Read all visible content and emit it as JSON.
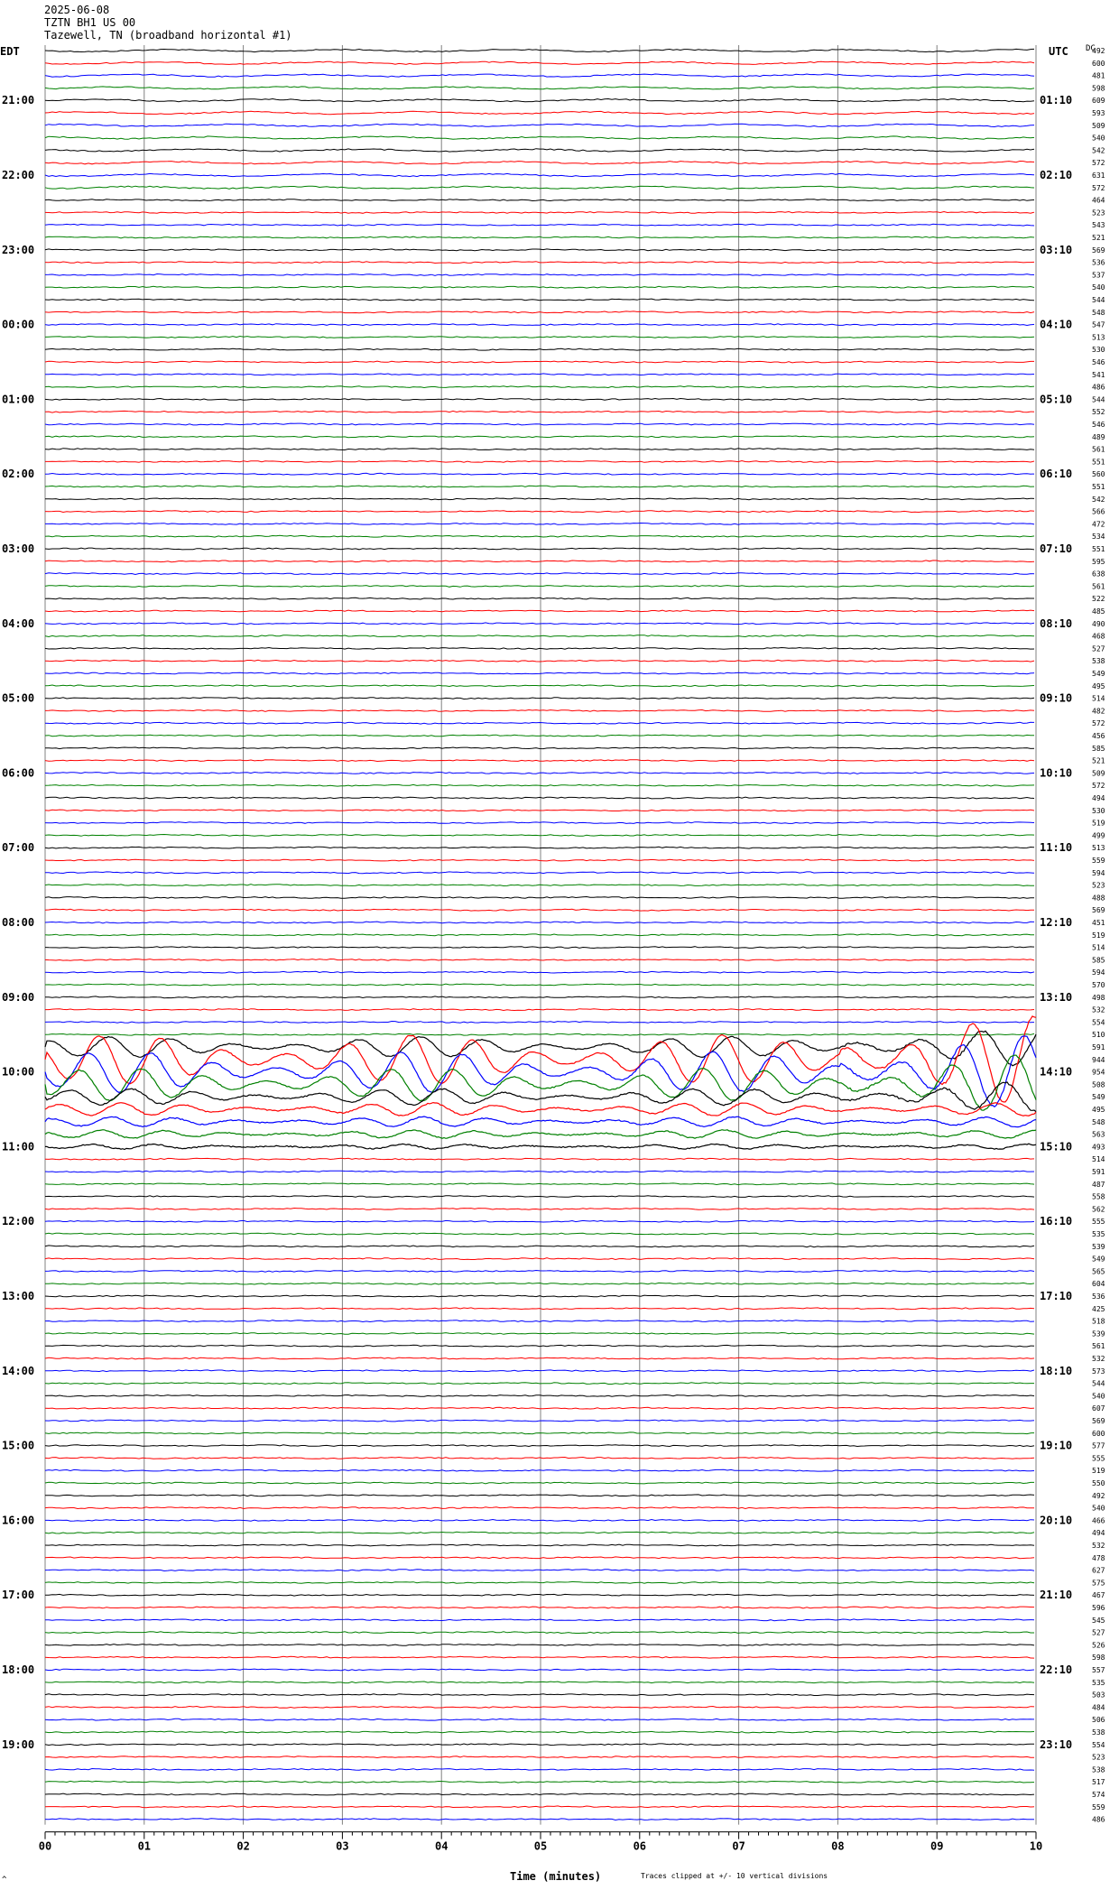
{
  "header": {
    "date": "2025-06-08",
    "station": "TZTN BH1 US 00",
    "location": "Tazewell, TN (broadband horizontal #1)"
  },
  "labels": {
    "left_tz": "EDT",
    "right_tz": "UTC",
    "right_col": "DC",
    "xlabel": "Time (minutes)",
    "clip_note": "Traces clipped at +/- 10 vertical divisions",
    "corner_mark": "^"
  },
  "chart_data": {
    "type": "line",
    "trace_colors": [
      "#000000",
      "#ff0000",
      "#0000ff",
      "#008000"
    ],
    "grid_color": "#808080",
    "x_ticks": [
      "00",
      "01",
      "02",
      "03",
      "04",
      "05",
      "06",
      "07",
      "08",
      "09",
      "10"
    ],
    "xlim": [
      0,
      10
    ],
    "left_hour_labels": [
      "21:00",
      "22:00",
      "23:00",
      "00:00",
      "01:00",
      "02:00",
      "03:00",
      "04:00",
      "05:00",
      "06:00",
      "07:00",
      "08:00",
      "09:00",
      "10:00",
      "11:00",
      "12:00",
      "13:00",
      "14:00",
      "15:00",
      "16:00",
      "17:00",
      "18:00",
      "19:00"
    ],
    "right_hour_labels": [
      "01:10",
      "02:10",
      "03:10",
      "04:10",
      "05:10",
      "06:10",
      "07:10",
      "08:10",
      "09:10",
      "10:10",
      "11:10",
      "12:10",
      "13:10",
      "14:10",
      "15:10",
      "16:10",
      "17:10",
      "18:10",
      "19:10",
      "20:10",
      "21:10",
      "22:10",
      "23:10"
    ],
    "dc_offsets": [
      "492",
      "600",
      "481",
      "598",
      "609",
      "593",
      "509",
      "540",
      "542",
      "572",
      "631",
      "572",
      "464",
      "523",
      "543",
      "521",
      "569",
      "536",
      "537",
      "540",
      "544",
      "548",
      "547",
      "513",
      "530",
      "546",
      "541",
      "486",
      "544",
      "552",
      "546",
      "489",
      "561",
      "551",
      "560",
      "551",
      "542",
      "566",
      "472",
      "534",
      "551",
      "595",
      "638",
      "561",
      "522",
      "485",
      "490",
      "468",
      "527",
      "538",
      "549",
      "495",
      "514",
      "482",
      "572",
      "456",
      "585",
      "521",
      "509",
      "572",
      "494",
      "530",
      "519",
      "499",
      "513",
      "559",
      "594",
      "523",
      "488",
      "569",
      "451",
      "519",
      "514",
      "585",
      "594",
      "570",
      "498",
      "532",
      "554",
      "510",
      "591",
      "944",
      "954",
      "508",
      "549",
      "495",
      "548",
      "563",
      "493",
      "514",
      "591",
      "487",
      "558",
      "562",
      "555",
      "535",
      "539",
      "549",
      "565",
      "604",
      "536",
      "425",
      "518",
      "539",
      "561",
      "532",
      "573",
      "544",
      "540",
      "607",
      "569",
      "600",
      "577",
      "555",
      "519",
      "550",
      "492",
      "540",
      "466",
      "494",
      "532",
      "478",
      "627",
      "575",
      "467",
      "596",
      "545",
      "527",
      "526",
      "598",
      "557",
      "535",
      "503",
      "484",
      "506",
      "538",
      "554",
      "523",
      "538",
      "517",
      "574",
      "559",
      "486"
    ],
    "event_rows": {
      "81": 6,
      "82": 5,
      "83": 4,
      "84": 2,
      "80": 2.5,
      "85": 1.6,
      "86": 1.2,
      "87": 1.0,
      "88": 0.6
    }
  }
}
